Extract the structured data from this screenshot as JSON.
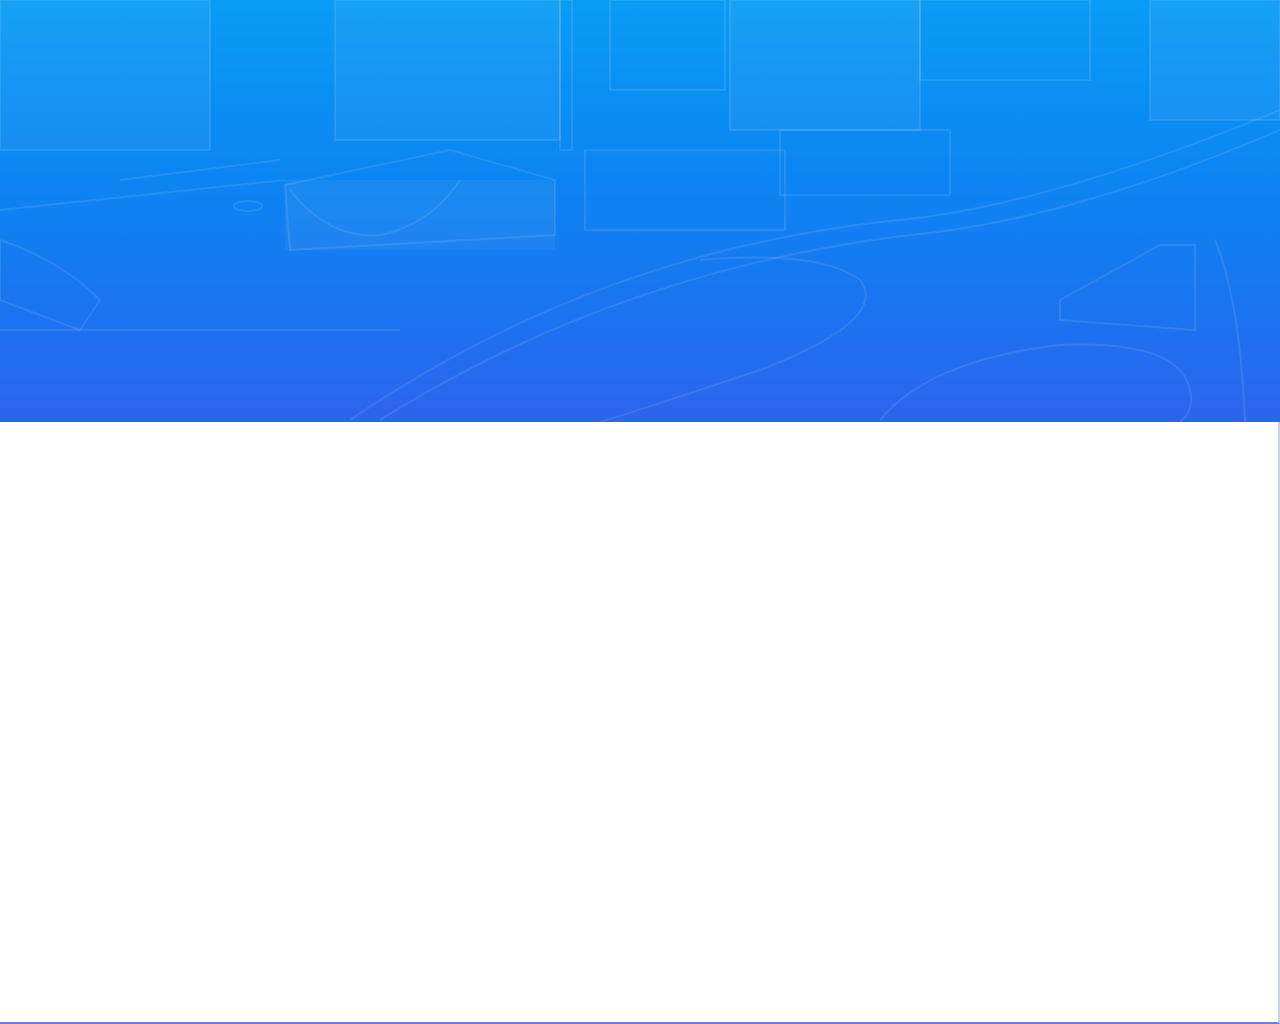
{
  "hero": {
    "image_description_icon": "city-aerial-icon",
    "gradient_top": "#0a9cf5",
    "gradient_bottom": "#2d63ee"
  },
  "content": {
    "background": "#ffffff"
  }
}
